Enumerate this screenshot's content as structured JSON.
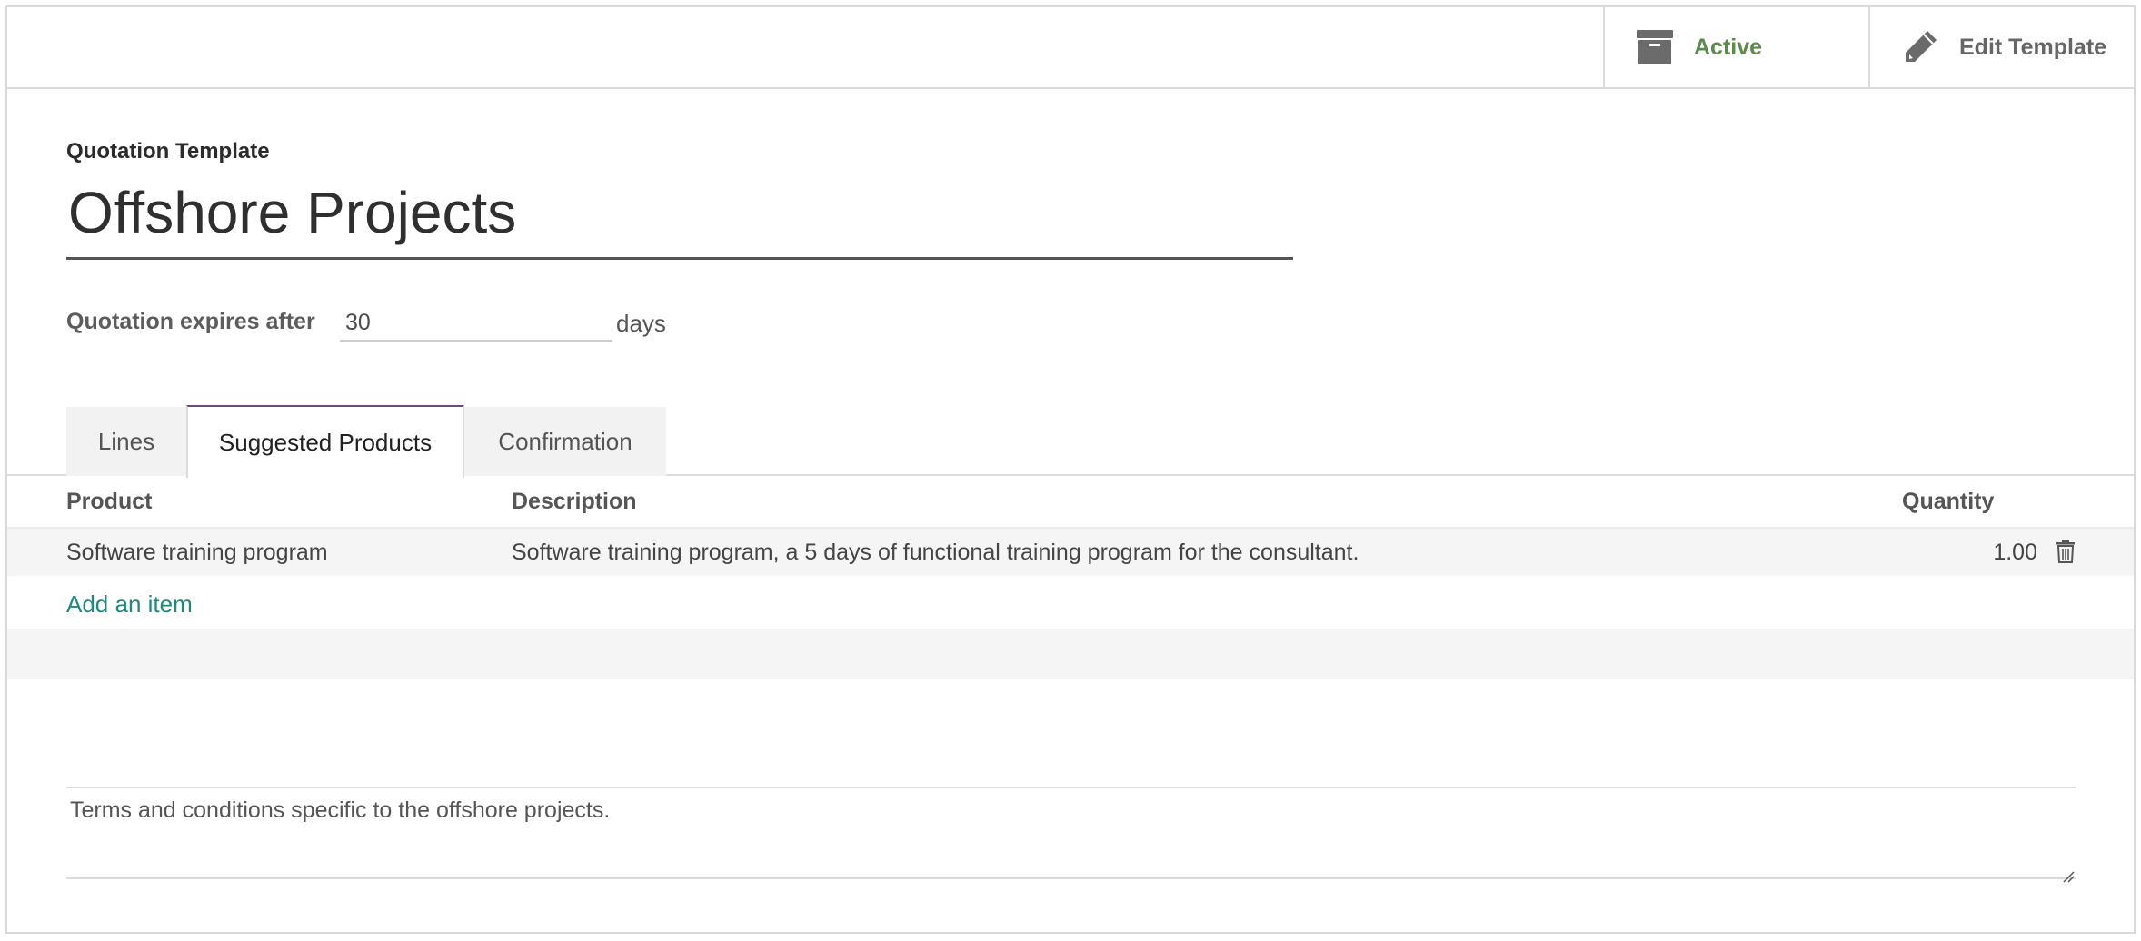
{
  "stat_buttons": {
    "active_label": "Active",
    "active_icon": "archive-icon",
    "edit_label": "Edit Template",
    "edit_icon": "pencil-icon"
  },
  "form": {
    "title_label": "Quotation Template",
    "title_value": "Offshore Projects",
    "expire_label": "Quotation expires after",
    "expire_value": "30",
    "expire_unit": "days"
  },
  "tabs": [
    {
      "label": "Lines",
      "active": false
    },
    {
      "label": "Suggested Products",
      "active": true
    },
    {
      "label": "Confirmation",
      "active": false
    }
  ],
  "table": {
    "headers": {
      "product": "Product",
      "description": "Description",
      "quantity": "Quantity"
    },
    "rows": [
      {
        "product": "Software training program",
        "description": "Software training program, a 5 days of functional training program for the consultant.",
        "quantity": "1.00"
      }
    ],
    "add_item_label": "Add an item"
  },
  "notes": {
    "value": "Terms and conditions specific to the offshore projects."
  },
  "colors": {
    "active_green": "#5b8a4a",
    "link_teal": "#1d8a7d",
    "tab_accent": "#6b4a7a"
  }
}
